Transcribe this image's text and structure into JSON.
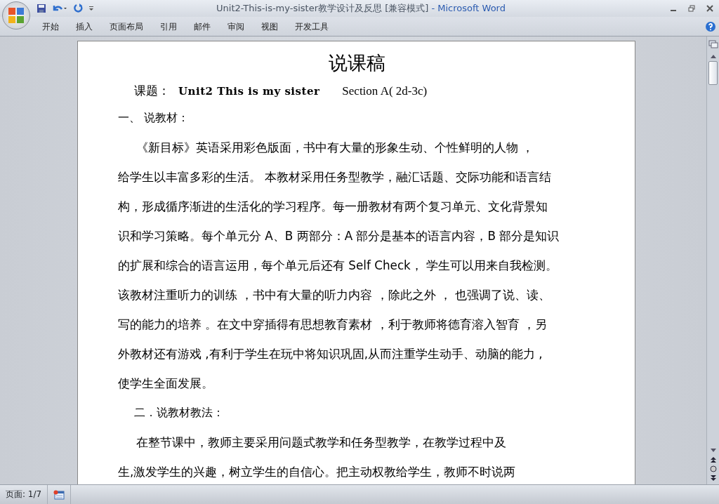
{
  "window": {
    "title": "Unit2-This-is-my-sister教学设计及反思 [兼容模式]",
    "app": " - Microsoft Word"
  },
  "ribbon_tabs": [
    {
      "label": "开始"
    },
    {
      "label": "插入"
    },
    {
      "label": "页面布局"
    },
    {
      "label": "引用"
    },
    {
      "label": "邮件"
    },
    {
      "label": "审阅"
    },
    {
      "label": "视图"
    },
    {
      "label": "开发工具"
    }
  ],
  "document": {
    "title": "说课稿",
    "subject_label": "课题：",
    "subject_title": "Unit2 This is my sister",
    "subject_section": "Section A( 2d-3c)",
    "blocks": [
      {
        "kind": "heading",
        "text": "一、  说教材："
      },
      {
        "kind": "paragraph",
        "lines": [
          "《新目标》英语采用彩色版面，书中有大量的形象生动、个性鲜明的人物 ，",
          "给学生以丰富多彩的生活。 本教材采用任务型教学，融汇话题、交际功能和语言结",
          "构，形成循序渐进的生活化的学习程序。每一册教材有两个复习单元、文化背景知",
          "识和学习策略。每个单元分 A、B 两部分：A 部分是基本的语言内容，B 部分是知识",
          "的扩展和综合的语言运用，每个单元后还有 Self Check， 学生可以用来自我检测。",
          "该教材注重听力的训练 ，书中有大量的听力内容 ，除此之外 ， 也强调了说、读、",
          "写的能力的培养 。在文中穿插得有思想教育素材 ，利于教师将德育溶入智育 ，另",
          "外教材还有游戏 ,有利于学生在玩中将知识巩固,从而注重学生动手、动脑的能力 ,",
          "使学生全面发展。"
        ]
      },
      {
        "kind": "indented_heading",
        "text": "二．说教材教法："
      },
      {
        "kind": "paragraph",
        "lines": [
          "在整节课中，教师主要采用问题式教学和任务型教学，在教学过程中及",
          "生,激发学生的兴趣，树立学生的自信心。把主动权教给学生，教师不时说两"
        ]
      }
    ]
  },
  "status_bar": {
    "page": "页面: 1/7"
  }
}
